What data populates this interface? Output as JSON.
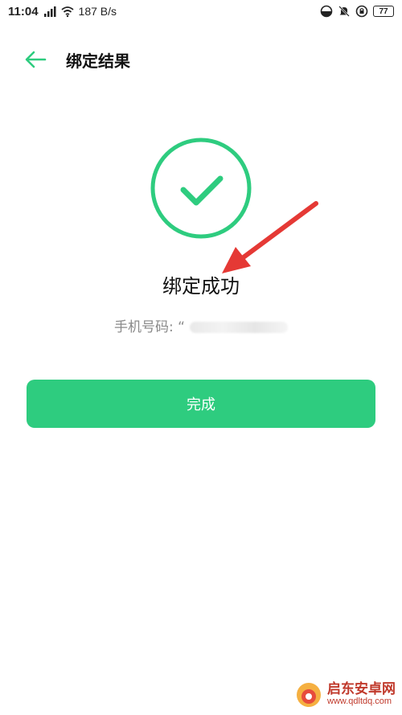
{
  "status_bar": {
    "time": "11:04",
    "network_speed": "187 B/s",
    "battery_level": "77"
  },
  "header": {
    "title": "绑定结果"
  },
  "result": {
    "message": "绑定成功",
    "phone_label": "手机号码: “"
  },
  "actions": {
    "done_label": "完成"
  },
  "watermark": {
    "site_name": "启东安卓网",
    "url": "www.qdltdq.com"
  },
  "colors": {
    "accent": "#2ecc7f",
    "arrow": "#e53935"
  }
}
